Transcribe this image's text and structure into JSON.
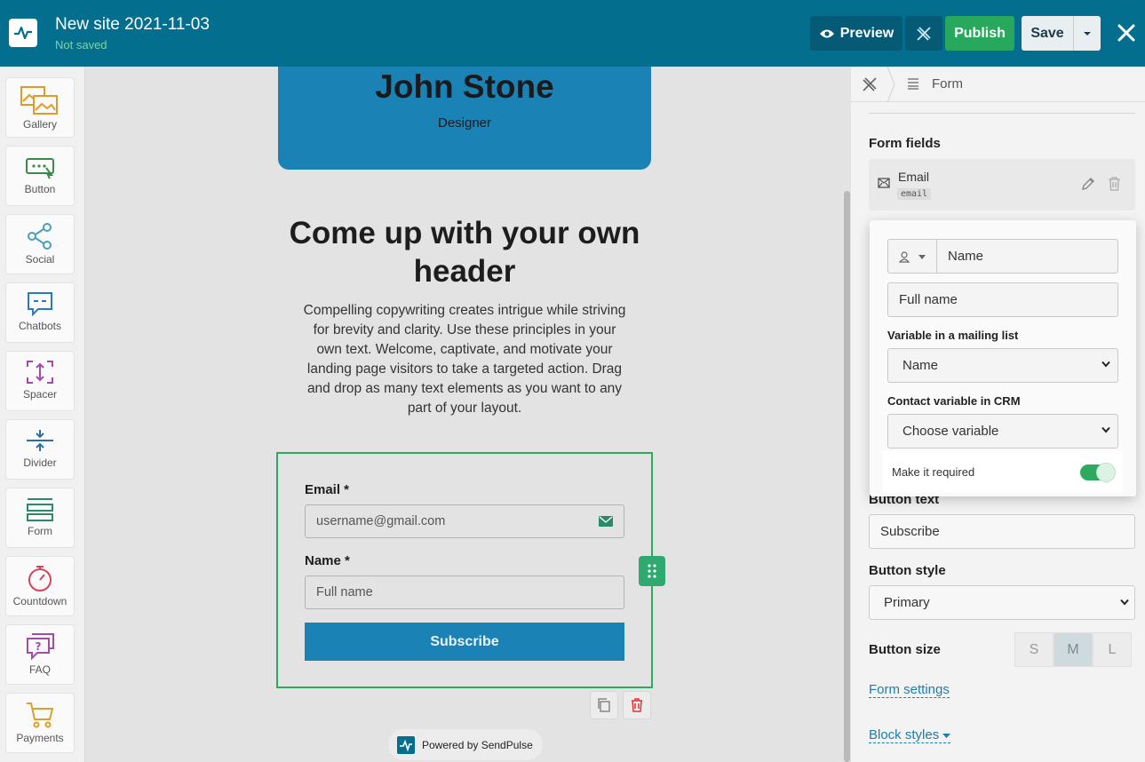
{
  "header": {
    "site_title": "New site 2021-11-03",
    "status": "Not saved",
    "preview_label": "Preview",
    "publish_label": "Publish",
    "save_label": "Save"
  },
  "sidebar": {
    "items": [
      {
        "label": "Gallery",
        "icon": "gallery-icon",
        "color": "#e09a2c"
      },
      {
        "label": "Button",
        "icon": "button-icon",
        "color": "#3a8a4a"
      },
      {
        "label": "Social",
        "icon": "share-icon",
        "color": "#4aa0b8"
      },
      {
        "label": "Chatbots",
        "icon": "chat-icon",
        "color": "#2a77c2"
      },
      {
        "label": "Spacer",
        "icon": "spacer-icon",
        "color": "#a54aa8"
      },
      {
        "label": "Divider",
        "icon": "divider-icon",
        "color": "#2a6fa0"
      },
      {
        "label": "Form",
        "icon": "form-icon",
        "color": "#2a8a6a"
      },
      {
        "label": "Countdown",
        "icon": "timer-icon",
        "color": "#d9425c"
      },
      {
        "label": "FAQ",
        "icon": "faq-icon",
        "color": "#a54aa8"
      },
      {
        "label": "Payments",
        "icon": "cart-icon",
        "color": "#d9a22c"
      }
    ]
  },
  "canvas": {
    "profile_name": "John Stone",
    "profile_role": "Designer",
    "headline": "Come up with your own header",
    "body": "Compelling copywriting creates intrigue while striving for brevity and clarity. Use these principles in your own text. Welcome, captivate, and motivate your landing page visitors to take a targeted action. Drag and drop as many text elements as you want to any part of your layout.",
    "form": {
      "email_label": "Email *",
      "email_placeholder": "username@gmail.com",
      "name_label": "Name *",
      "name_placeholder": "Full name",
      "submit_label": "Subscribe"
    },
    "powered_by": "Powered by SendPulse"
  },
  "panel": {
    "breadcrumb": "Form",
    "form_fields_title": "Form fields",
    "email_field": {
      "label": "Email",
      "tag": "email"
    },
    "popover": {
      "name_value": "Name",
      "full_name_value": "Full name",
      "mailing_var_label": "Variable in a mailing list",
      "mailing_var_value": "Name",
      "crm_var_label": "Contact variable in CRM",
      "crm_var_value": "Choose variable",
      "required_label": "Make it required",
      "required_on": true
    },
    "button_text_title": "Button text",
    "button_text_value": "Subscribe",
    "button_style_title": "Button style",
    "button_style_value": "Primary",
    "button_size_title": "Button size",
    "sizes": [
      "S",
      "M",
      "L"
    ],
    "active_size": "M",
    "form_settings_link": "Form settings",
    "block_styles_link": "Block styles"
  },
  "colors": {
    "topbar": "#046e8f",
    "accent_blue": "#1b82b5",
    "accent_green": "#2eaa5e",
    "publish": "#28a85d"
  }
}
